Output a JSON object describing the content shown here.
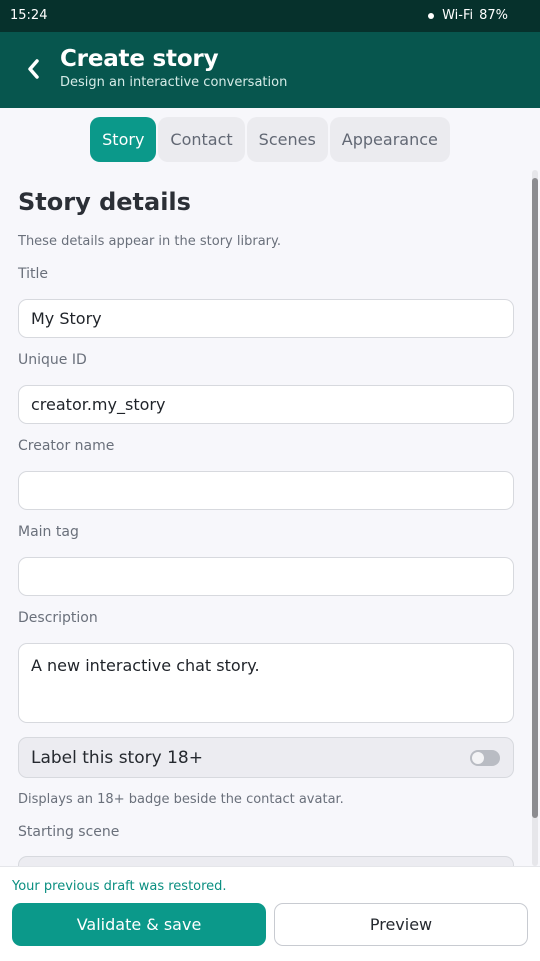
{
  "status_bar": {
    "time": "15:24",
    "network": "Wi-Fi",
    "battery": "87%"
  },
  "header": {
    "title": "Create story",
    "subtitle": "Design an interactive conversation",
    "back_icon": "chevron-left-icon"
  },
  "tabs": [
    {
      "label": "Story",
      "active": true
    },
    {
      "label": "Contact",
      "active": false
    },
    {
      "label": "Scenes",
      "active": false
    },
    {
      "label": "Appearance",
      "active": false
    }
  ],
  "story_details": {
    "section_title": "Story details",
    "helper_text": "These details appear in the story library.",
    "fields": {
      "title": {
        "label": "Title",
        "value": "My Story"
      },
      "unique_id": {
        "label": "Unique ID",
        "value": "creator.my_story"
      },
      "creator_name": {
        "label": "Creator name",
        "value": ""
      },
      "main_tag": {
        "label": "Main tag",
        "value": ""
      },
      "description": {
        "label": "Description",
        "value": "A new interactive chat story."
      }
    },
    "adult_toggle": {
      "label": "Label this story 18+",
      "checked": false,
      "helper_text": "Displays an 18+ badge beside the contact avatar."
    },
    "starting_scene": {
      "label": "Starting scene"
    }
  },
  "footer": {
    "restore_message": "Your previous draft was restored.",
    "primary_button": "Validate & save",
    "secondary_button": "Preview"
  },
  "colors": {
    "header": "#07564e",
    "status_bar": "#06312c",
    "accent": "#0b998a",
    "background": "#f7f7fb"
  }
}
